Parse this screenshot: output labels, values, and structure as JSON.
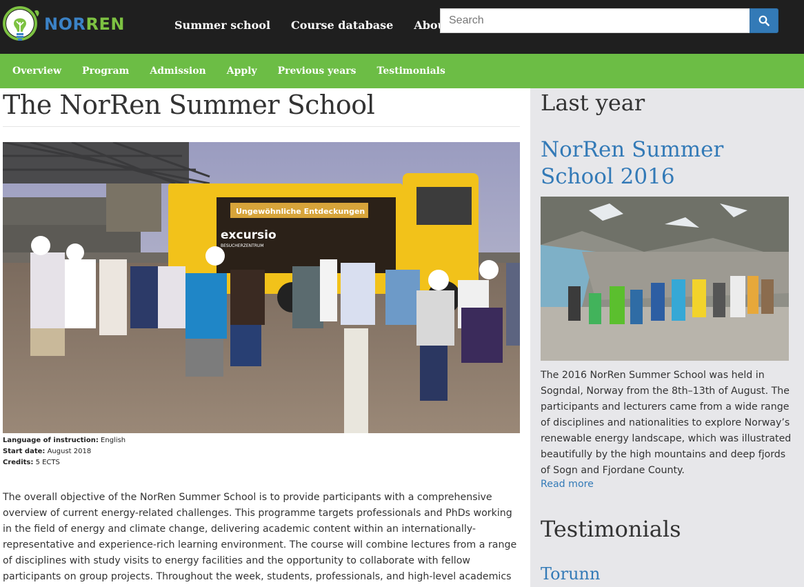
{
  "header": {
    "logo_text_part1": "NOR",
    "logo_text_part2": "REN",
    "nav": [
      "Summer school",
      "Course database",
      "About us"
    ],
    "search_placeholder": "Search"
  },
  "subnav": {
    "items": [
      "Overview",
      "Program",
      "Admission",
      "Apply",
      "Previous years",
      "Testimonials"
    ]
  },
  "main": {
    "title": "The NorRen Summer School",
    "facts": [
      {
        "label": "Language of instruction:",
        "value": "English"
      },
      {
        "label": "Start date:",
        "value": "August 2018"
      },
      {
        "label": "Credits:",
        "value": "5 ECTS"
      }
    ],
    "intro": "The overall objective of the NorRen Summer School is to provide participants with a comprehensive overview of current energy-related challenges. This programme targets professionals and PhDs working in the field of energy and climate change, delivering academic content within an internationally-representative and experience-rich learning environment. The course will combine lectures from a range of disciplines with study visits to energy facilities and the opportunity to collaborate with fellow participants on group projects. Throughout the week, students, professionals, and high-level academics",
    "photo_truck_text_1": "Ungewöhnliche Entdeckungen",
    "photo_truck_text_2": "excursio",
    "photo_truck_text_3": "BESUCHERZENTRUM"
  },
  "sidebar": {
    "last_year_heading": "Last year",
    "event_title": "NorRen Summer School 2016",
    "event_description": "The 2016 NorRen Summer School was held in Sogndal, Norway from the 8th–13th of August. The participants and lecturers came from a wide range of disciplines and nationalities to explore Norway’s renewable energy landscape, which was illustrated beautifully by the high mountains and deep fjords of Sogn and Fjordane County.",
    "read_more": "Read more",
    "testimonials_heading": "Testimonials",
    "testimonial_name": "Torunn"
  },
  "colors": {
    "header_bg": "#1f1f1f",
    "subnav_bg": "#6cbd45",
    "link_blue": "#337ab7",
    "sidebar_bg": "#e7e7ea"
  }
}
